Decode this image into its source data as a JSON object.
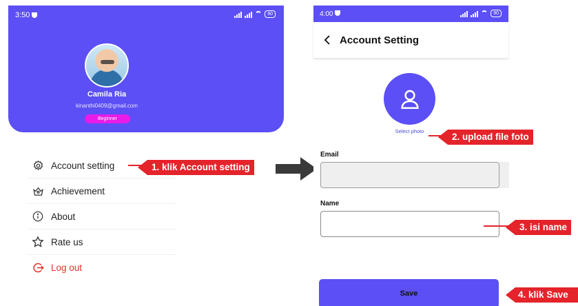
{
  "left_screen": {
    "status": {
      "time": "3:50",
      "battery": "90"
    },
    "profile": {
      "name": "Camila Ria",
      "email": "kinanthi0409@gmail.com",
      "level": "Beginner"
    },
    "menu": [
      {
        "label": "Account setting",
        "icon": "gear-icon"
      },
      {
        "label": "Achievement",
        "icon": "trophy-icon"
      },
      {
        "label": "About",
        "icon": "info-icon"
      },
      {
        "label": "Rate us",
        "icon": "star-icon"
      },
      {
        "label": "Log out",
        "icon": "logout-icon"
      }
    ]
  },
  "right_screen": {
    "status": {
      "time": "4:00",
      "battery": "90"
    },
    "title": "Account Setting",
    "select_photo": "Select photo",
    "email_label": "Email",
    "email_value": "",
    "name_label": "Name",
    "name_value": "",
    "save_label": "Save"
  },
  "callouts": {
    "step1": "1. klik Account setting",
    "step2": "2. upload file foto",
    "step3": "3. isi name",
    "step4": "4. klik Save"
  },
  "colors": {
    "primary": "#5b4ff5",
    "badge": "#e81ce8",
    "callout": "#e4232b",
    "logout": "#e4322b"
  }
}
